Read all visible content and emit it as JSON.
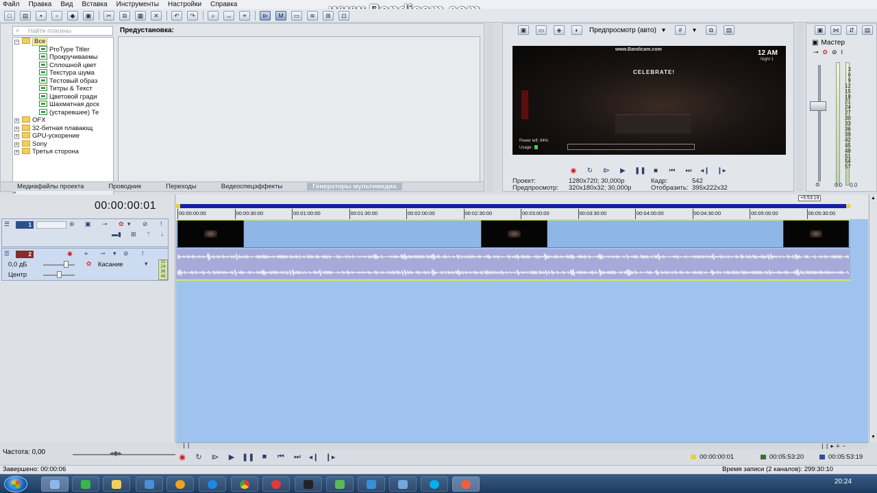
{
  "menu": [
    "Файл",
    "Правка",
    "Вид",
    "Вставка",
    "Инструменты",
    "Настройки",
    "Справка"
  ],
  "watermark": "www.Bandicam.com",
  "explorer": {
    "search_placeholder": "Найти плагины",
    "preset_label": "Предустановка:",
    "tree": [
      {
        "label": "Все",
        "type": "folder",
        "selected": true,
        "level": 0
      },
      {
        "label": "ProType Titler",
        "type": "gen",
        "level": 1
      },
      {
        "label": "Прокручиваемы",
        "type": "gen",
        "level": 1
      },
      {
        "label": "Сплошной цвет",
        "type": "gen",
        "level": 1
      },
      {
        "label": "Текстура шума",
        "type": "gen",
        "level": 1
      },
      {
        "label": "Тестовый образ",
        "type": "gen",
        "level": 1
      },
      {
        "label": "Титры & Текст",
        "type": "gen",
        "level": 1
      },
      {
        "label": "Цветовой гради",
        "type": "gen",
        "level": 1
      },
      {
        "label": "Шахматная доск",
        "type": "gen",
        "level": 1
      },
      {
        "label": "(устаревшее) Те",
        "type": "gen",
        "level": 1
      },
      {
        "label": "OFX",
        "type": "folder",
        "level": 0
      },
      {
        "label": "32-битная плавающ",
        "type": "folder",
        "level": 0
      },
      {
        "label": "GPU-ускорение",
        "type": "folder",
        "level": 0
      },
      {
        "label": "Sony",
        "type": "folder",
        "level": 0
      },
      {
        "label": "Третья сторона",
        "type": "folder",
        "level": 0
      }
    ],
    "tabs": [
      "Медиафайлы проекта",
      "Проводник",
      "Переходы",
      "Видеоспецэффекты",
      "Генераторы мультимедиа"
    ],
    "active_tab": 4
  },
  "preview": {
    "mode_label": "Предпросмотр (авто)",
    "screen": {
      "watermark": "www.Bandicam.com",
      "time": "12 AM",
      "night": "Night 1",
      "sign": "CELEBRATE!",
      "power": "Power left: 94%",
      "usage": "Usage:"
    },
    "info": {
      "project_label": "Проект:",
      "project_value": "1280x720; 30,000p",
      "preview_label": "Предпросмотр:",
      "preview_value": "320x180x32; 30,000p",
      "frame_label": "Кадр:",
      "frame_value": "542",
      "display_label": "Отобразить:",
      "display_value": "395x222x32"
    }
  },
  "master": {
    "title": "Мастер",
    "scale": [
      "3",
      "6",
      "9",
      "12",
      "15",
      "18",
      "21",
      "24",
      "27",
      "30",
      "33",
      "36",
      "39",
      "42",
      "45",
      "48",
      "51",
      "54",
      "57"
    ],
    "foot_left": "0.0",
    "foot_right": "0.0"
  },
  "timeline": {
    "timecode": "00:00:00:01",
    "end_timecode": "+5:53:19",
    "ruler": [
      "00:00:00:00",
      "00:00:30:00",
      "00:01:00:00",
      "00:01:30:00",
      "00:02:00:00",
      "00:02:30:00",
      "00:03:00:00",
      "00:03:30:00",
      "00:04:00:00",
      "00:04:30:00",
      "00:05:00:00",
      "00:05:30:00"
    ],
    "video_track": {
      "number": "1"
    },
    "audio_track": {
      "number": "2",
      "volume": "0,0 дБ",
      "pan": "Центр",
      "mode": "Касание",
      "meter": [
        "12",
        "24",
        "36",
        "48"
      ]
    }
  },
  "transport": {
    "rate_label": "Частота: 0,00",
    "cursor_tc": "00:00:00:01",
    "selection_tc": "00:05:53:20",
    "length_tc": "00:05:53:19"
  },
  "status": {
    "left": "Завершено: 00:00:06",
    "right": "Время записи (2 каналов): 299:30:10"
  },
  "taskbar": {
    "clock": "20:24"
  }
}
